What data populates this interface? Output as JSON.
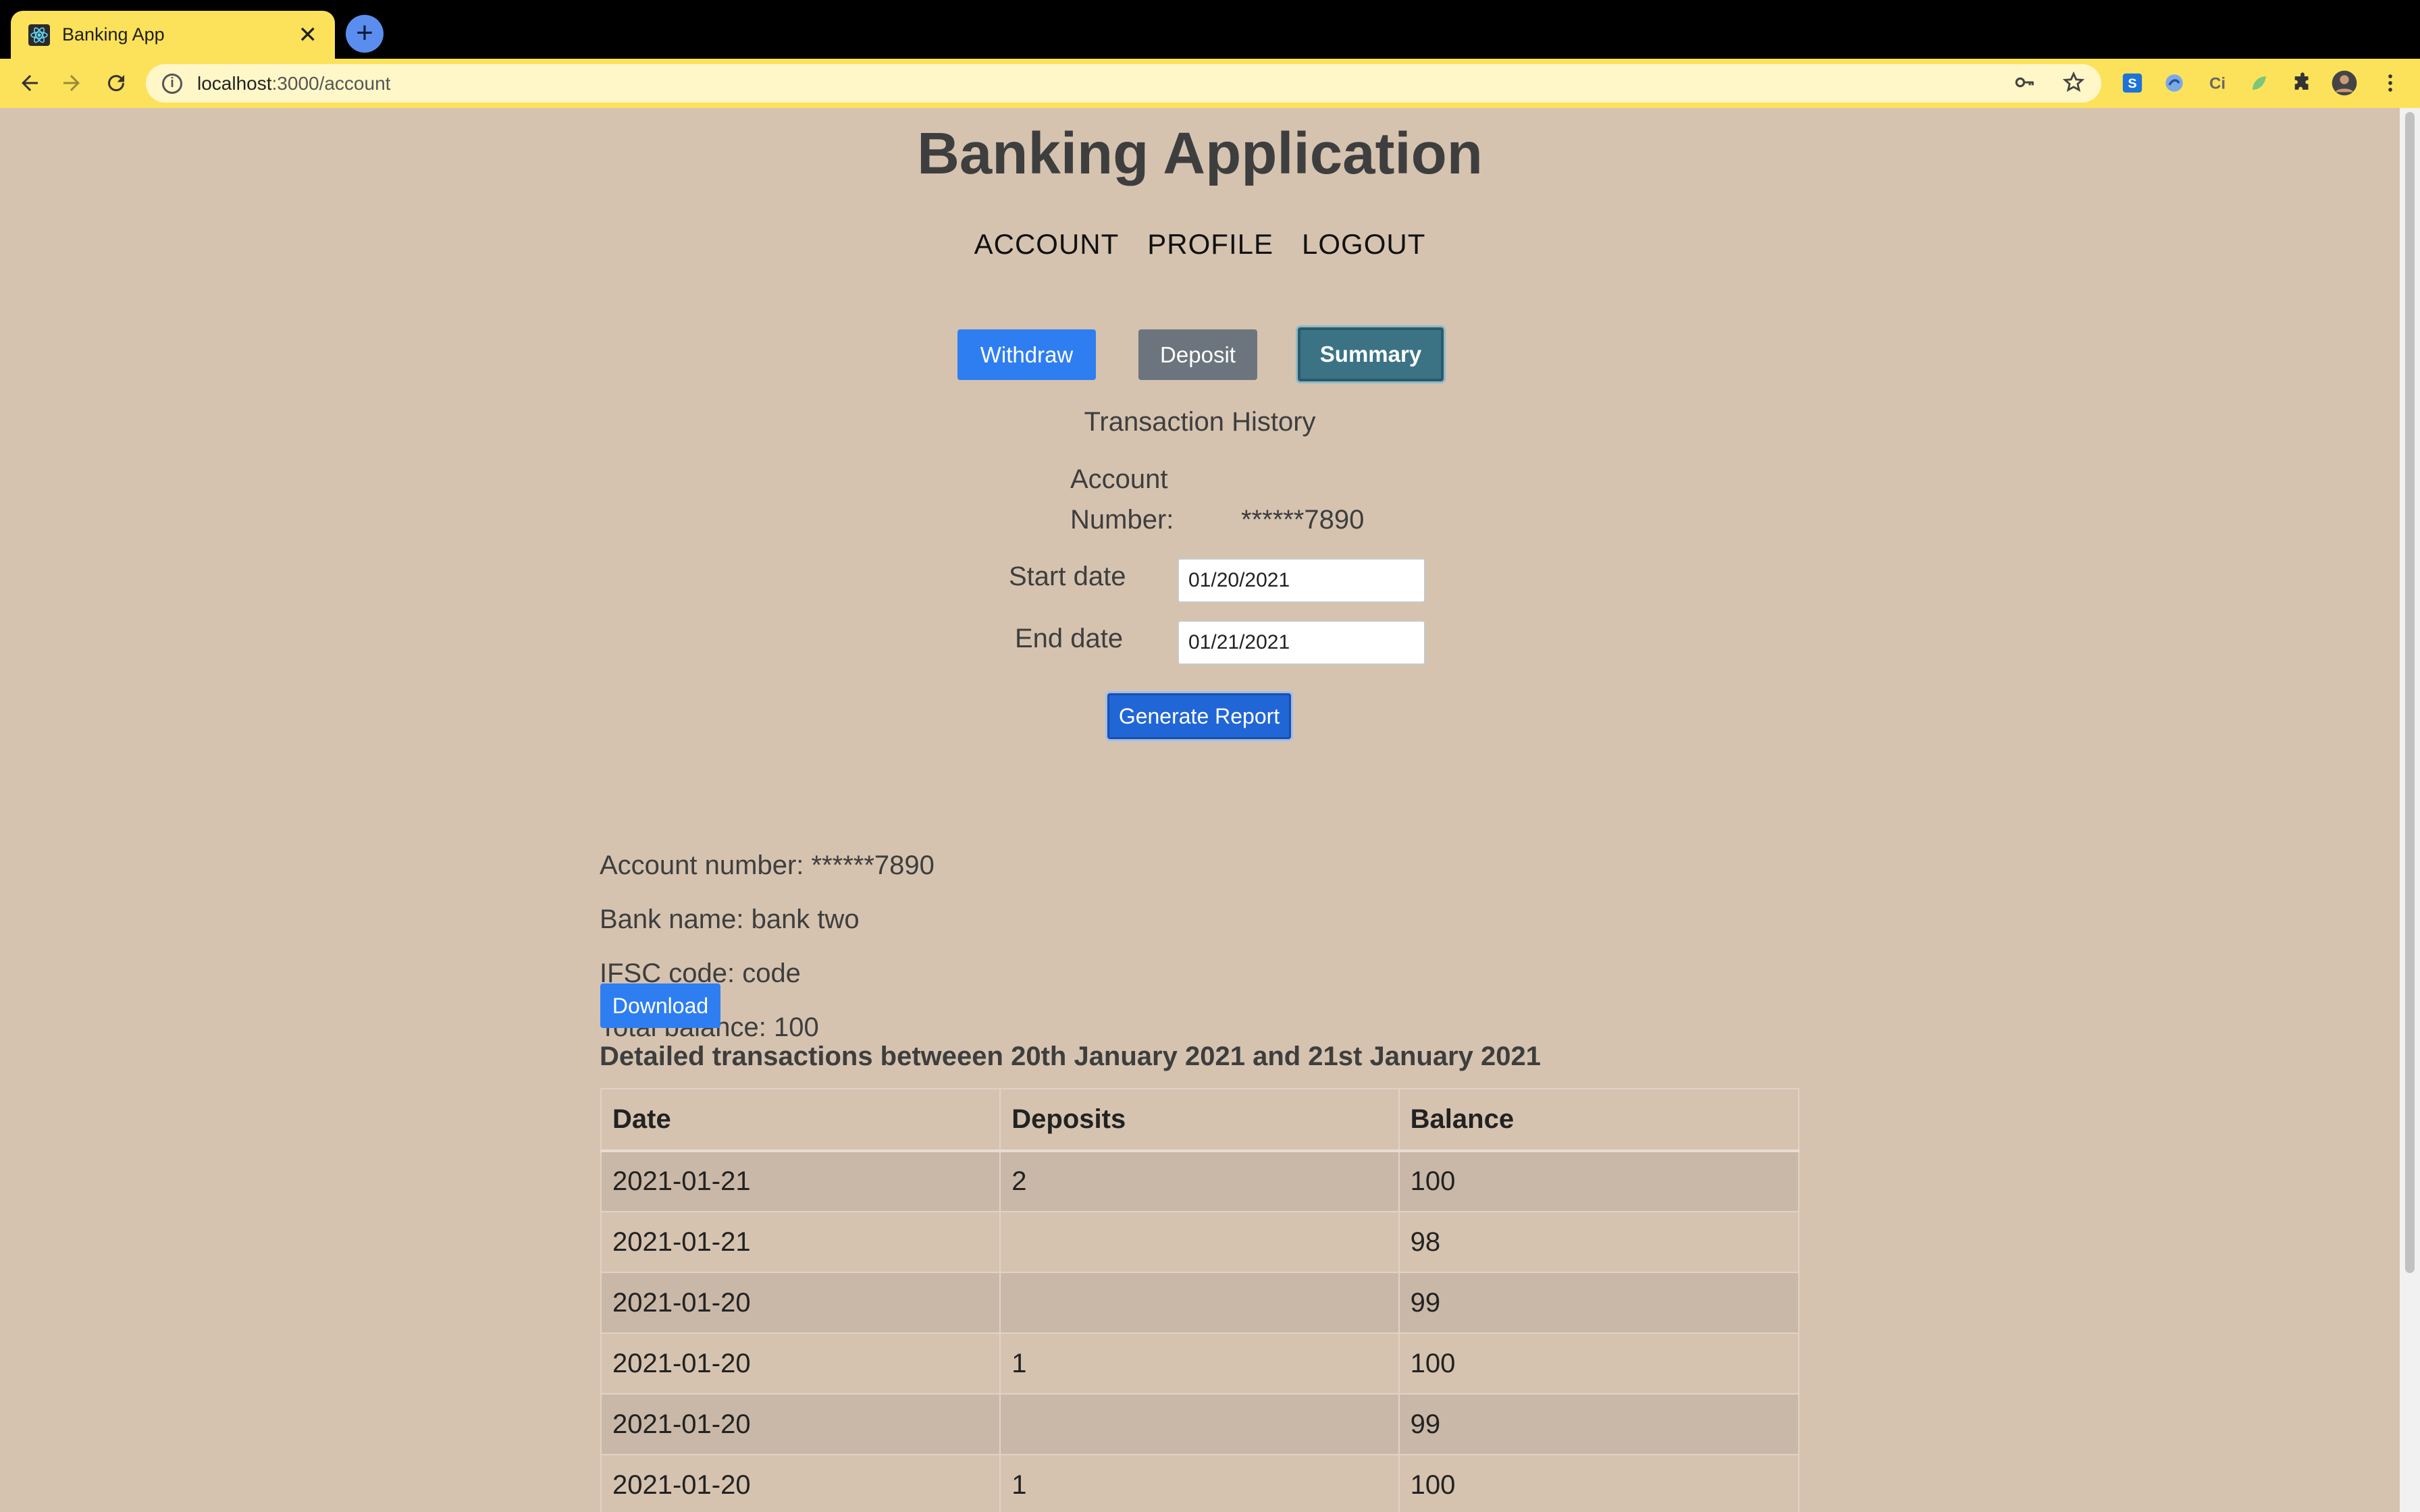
{
  "browser": {
    "tab_title": "Banking App",
    "url_host": "localhost",
    "url_path": ":3000/account"
  },
  "app": {
    "title": "Banking Application",
    "nav": [
      "ACCOUNT",
      "PROFILE",
      "LOGOUT"
    ]
  },
  "actions": {
    "withdraw": "Withdraw",
    "deposit": "Deposit",
    "summary": "Summary"
  },
  "summary": {
    "heading": "Transaction History",
    "account_label_line1": "Account",
    "account_label_line2": "Number:",
    "account_masked": "******7890",
    "start_label": "Start date",
    "start_value": "01/20/2021",
    "end_label": "End date",
    "end_value": "01/21/2021",
    "generate": "Generate Report"
  },
  "report": {
    "account_number": "Account number: ******7890",
    "bank_name": "Bank name: bank two",
    "ifsc": "IFSC code: code",
    "total_balance": "Total balance: 100",
    "download": "Download",
    "detail_heading": "Detailed transactions betweeen 20th January 2021 and 21st January 2021",
    "columns": [
      "Date",
      "Deposits",
      "Balance"
    ],
    "rows": [
      [
        "2021-01-21",
        "2",
        "100"
      ],
      [
        "2021-01-21",
        "",
        "98"
      ],
      [
        "2021-01-20",
        "",
        "99"
      ],
      [
        "2021-01-20",
        "1",
        "100"
      ],
      [
        "2021-01-20",
        "",
        "99"
      ],
      [
        "2021-01-20",
        "1",
        "100"
      ]
    ]
  },
  "colors": {
    "page_bg": "#d5c3b0",
    "chrome": "#fce25a",
    "primary": "#2e7ef2",
    "secondary": "#6c757d",
    "summary_active": "#3b7385",
    "row_stripe": "#c9b8a7"
  }
}
